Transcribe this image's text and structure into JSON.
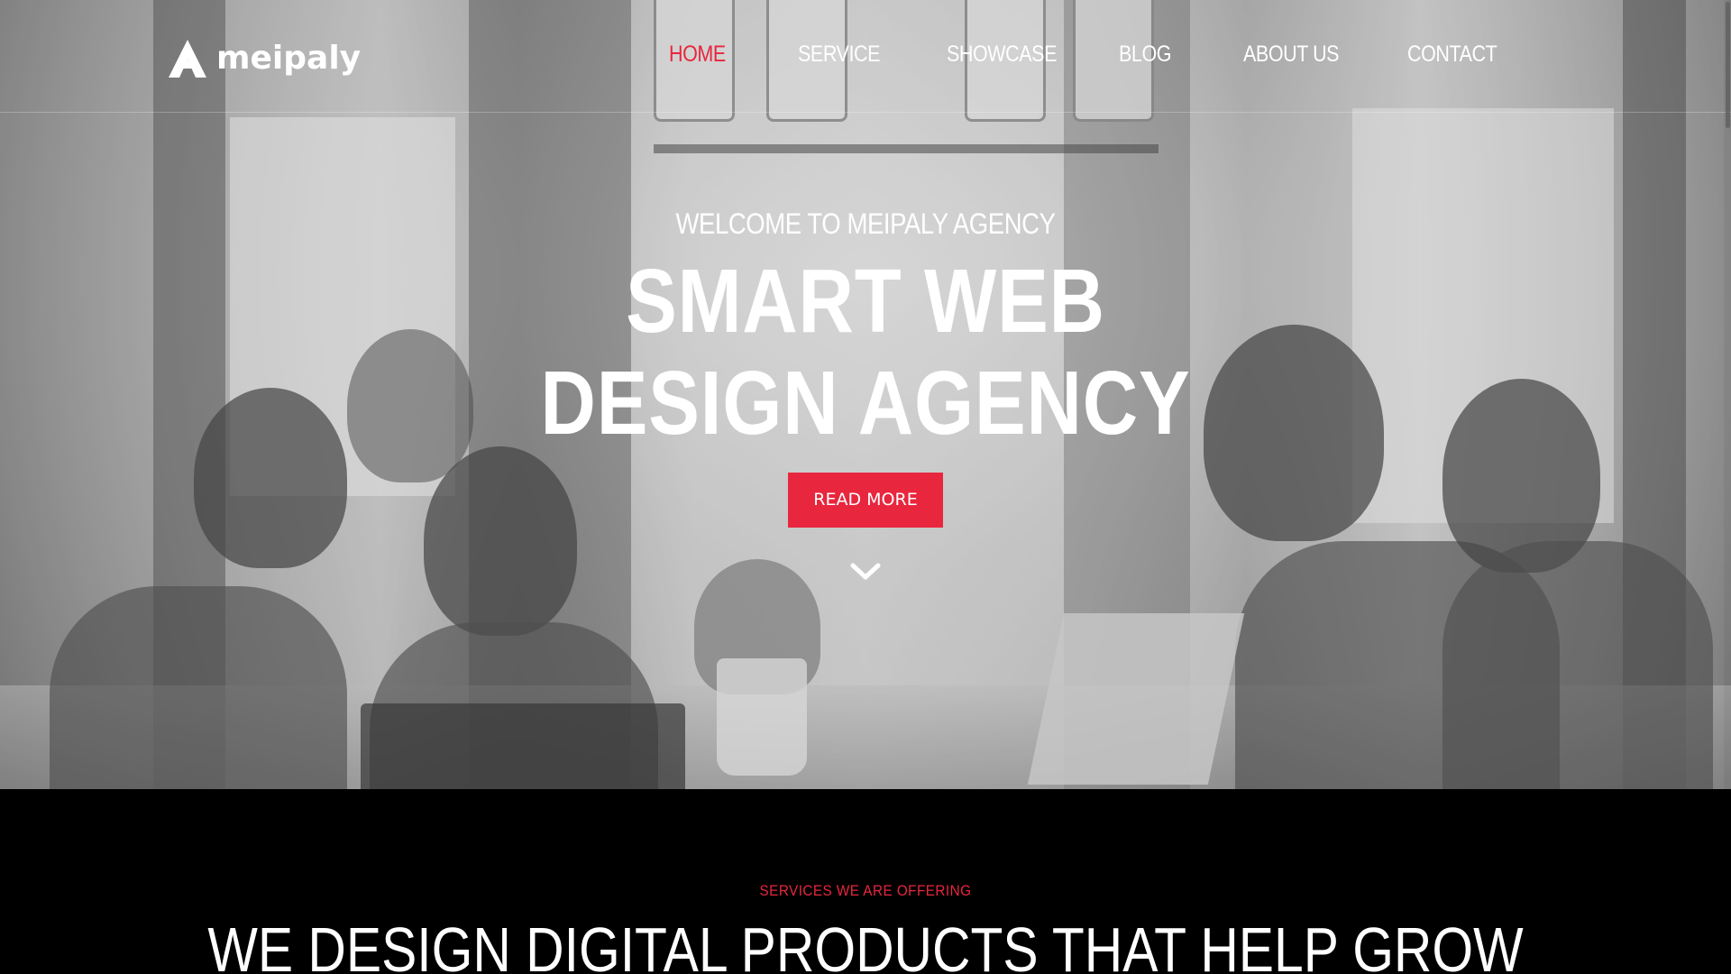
{
  "brand": {
    "name": "meipaly",
    "logo_icon": "triangle-logo-icon"
  },
  "nav": {
    "items": [
      {
        "label": "HOME",
        "active": true
      },
      {
        "label": "SERVICE",
        "active": false
      },
      {
        "label": "SHOWCASE",
        "active": false
      },
      {
        "label": "BLOG",
        "active": false
      },
      {
        "label": "ABOUT US",
        "active": false
      },
      {
        "label": "CONTACT",
        "active": false
      }
    ]
  },
  "hero": {
    "eyebrow": "WELCOME TO MEIPALY AGENCY",
    "headline_line1": "SMART WEB",
    "headline_line2": "DESIGN AGENCY",
    "cta_label": "READ MORE",
    "scroll_icon": "chevron-down-icon"
  },
  "services": {
    "label": "SERVICES WE ARE OFFERING",
    "title": "WE DESIGN DIGITAL PRODUCTS THAT HELP GROW"
  },
  "colors": {
    "accent": "#e8263d",
    "text_light": "#ffffff",
    "dark_bg": "#000000"
  }
}
